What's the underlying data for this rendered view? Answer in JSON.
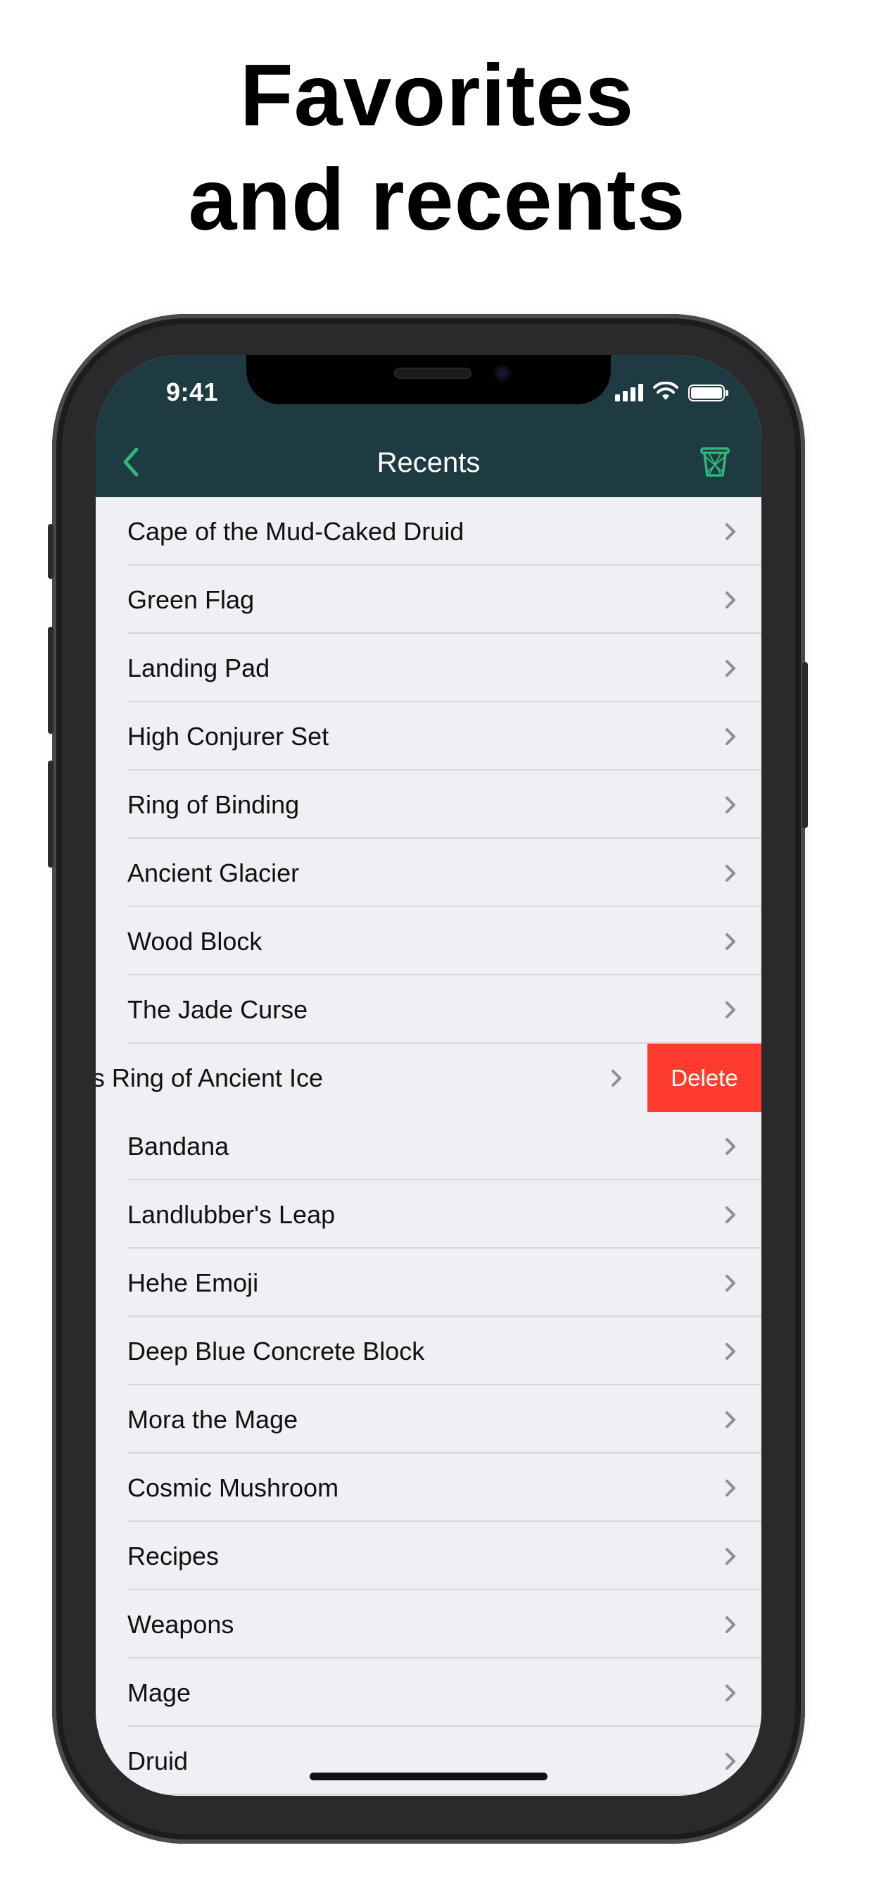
{
  "headline": {
    "line1": "Favorites",
    "line2": "and recents"
  },
  "status_bar": {
    "time": "9:41",
    "icons": [
      "cellular-signal-icon",
      "wifi-icon",
      "battery-icon"
    ]
  },
  "nav": {
    "title": "Recents",
    "back_icon": "chevron-left-icon",
    "trash_icon": "trash-bin-icon",
    "accent_color": "#2fb877",
    "bar_color": "#1f3b42"
  },
  "list": {
    "items": [
      {
        "label": "Cape of the Mud-Caked Druid"
      },
      {
        "label": "Green Flag"
      },
      {
        "label": "Landing Pad"
      },
      {
        "label": "High Conjurer Set"
      },
      {
        "label": "Ring of Binding"
      },
      {
        "label": "Ancient Glacier"
      },
      {
        "label": "Wood Block"
      },
      {
        "label": "The Jade Curse"
      },
      {
        "label": "k's Ring of Ancient Ice",
        "swiped": true
      },
      {
        "label": "Bandana"
      },
      {
        "label": "Landlubber's Leap"
      },
      {
        "label": "Hehe Emoji"
      },
      {
        "label": "Deep Blue Concrete Block"
      },
      {
        "label": "Mora the Mage"
      },
      {
        "label": "Cosmic Mushroom"
      },
      {
        "label": "Recipes"
      },
      {
        "label": "Weapons"
      },
      {
        "label": "Mage"
      },
      {
        "label": "Druid"
      }
    ],
    "delete_label": "Delete",
    "delete_color": "#ff3b30"
  }
}
